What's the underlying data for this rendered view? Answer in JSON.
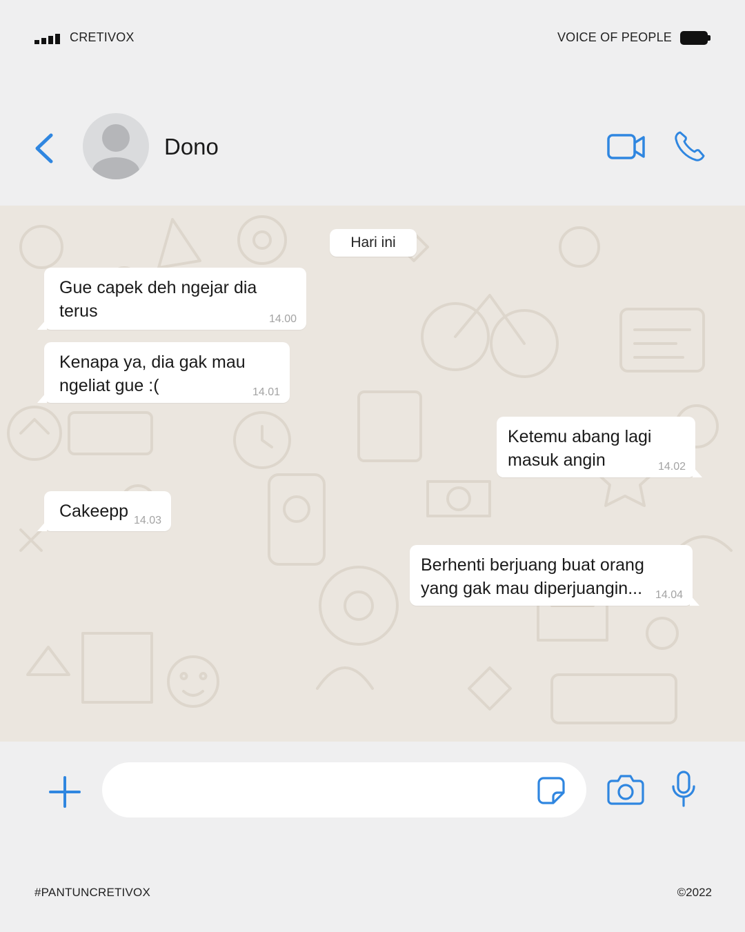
{
  "status_bar": {
    "carrier": "CRETIVOX",
    "right_label": "VOICE OF PEOPLE"
  },
  "header": {
    "contact_name": "Dono",
    "icons": {
      "back": "chevron-left-icon",
      "avatar": "person-silhouette",
      "video": "video-camera-icon",
      "call": "phone-icon"
    }
  },
  "chat": {
    "date_label": "Hari ini",
    "messages": [
      {
        "direction": "incoming",
        "line1": "Gue capek deh ngejar dia",
        "line2": "terus",
        "time": "14.00"
      },
      {
        "direction": "incoming",
        "line1": "Kenapa ya, dia gak mau",
        "line2": "ngeliat gue :(",
        "time": "14.01"
      },
      {
        "direction": "outgoing",
        "line1": "Ketemu abang lagi",
        "line2": "masuk angin",
        "time": "14.02"
      },
      {
        "direction": "incoming",
        "line1": "Cakeepp",
        "line2": "",
        "time": "14.03"
      },
      {
        "direction": "outgoing",
        "line1": "Berhenti berjuang buat orang",
        "line2": "yang gak mau diperjuangin...",
        "time": "14.04"
      }
    ]
  },
  "input_bar": {
    "message_value": "",
    "icons": {
      "add": "plus-icon",
      "sticker": "sticker-icon",
      "camera": "camera-icon",
      "mic": "microphone-icon"
    }
  },
  "footer": {
    "hashtag": "#PANTUNCRETIVOX",
    "copyright": "©2022"
  },
  "colors": {
    "accent": "#2f86e0",
    "background": "#efeff0",
    "chat_background": "#ebe6df",
    "bubble": "#ffffff",
    "timestamp": "#a3a3a3"
  }
}
